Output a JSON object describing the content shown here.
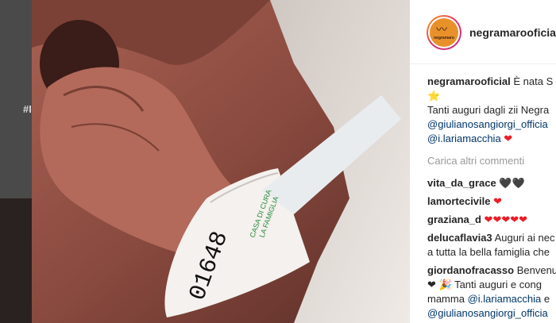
{
  "background": {
    "hashtag_fragment": "#I"
  },
  "post": {
    "account": {
      "username": "negramarooficial",
      "avatar_label": "negramaro"
    },
    "caption": {
      "user": "negramarooficial",
      "line1": "È nata S",
      "line2": "⭐",
      "line3": "Tanti auguri dagli zii Negra",
      "mention1": "@giulianosangiorgi_officia",
      "mention2": "@i.lariamacchia",
      "heart": "❤"
    },
    "load_more": "Carica altri commenti",
    "comments": [
      {
        "user": "vita_da_grace",
        "text": "🖤🖤"
      },
      {
        "user": "lamortecivile",
        "text": "❤"
      },
      {
        "user": "graziana_d",
        "text": "❤❤❤❤❤"
      },
      {
        "user": "delucaflavia3",
        "text": "Auguri ai nec",
        "line2": "a tutta la bella famiglia che"
      },
      {
        "user": "giordanofracasso",
        "text": "Benvenu",
        "line2": "❤ 🎉 Tanti auguri e cong",
        "line3_text": "mamma ",
        "line3_mention": "@i.lariamacchia",
        "line3_tail": " e",
        "line4_mention": "@giulianosangiorgi_officia"
      }
    ]
  },
  "colors": {
    "text": "#262626",
    "mention": "#003569",
    "muted": "#999999",
    "heart": "#ed1c24"
  }
}
